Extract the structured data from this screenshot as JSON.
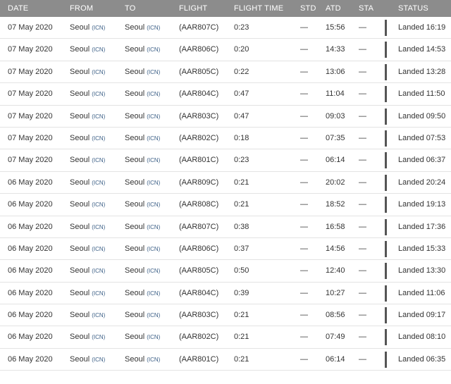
{
  "columns": {
    "date": "DATE",
    "from": "FROM",
    "to": "TO",
    "flight": "FLIGHT",
    "flight_time": "FLIGHT TIME",
    "std": "STD",
    "atd": "ATD",
    "sta": "STA",
    "status": "STATUS"
  },
  "rows": [
    {
      "date": "07 May 2020",
      "from_city": "Seoul",
      "from_code": "(ICN)",
      "to_city": "Seoul",
      "to_code": "(ICN)",
      "flight": "(AAR807C)",
      "flight_time": "0:23",
      "std": "—",
      "atd": "15:56",
      "sta": "—",
      "status": "Landed 16:19"
    },
    {
      "date": "07 May 2020",
      "from_city": "Seoul",
      "from_code": "(ICN)",
      "to_city": "Seoul",
      "to_code": "(ICN)",
      "flight": "(AAR806C)",
      "flight_time": "0:20",
      "std": "—",
      "atd": "14:33",
      "sta": "—",
      "status": "Landed 14:53"
    },
    {
      "date": "07 May 2020",
      "from_city": "Seoul",
      "from_code": "(ICN)",
      "to_city": "Seoul",
      "to_code": "(ICN)",
      "flight": "(AAR805C)",
      "flight_time": "0:22",
      "std": "—",
      "atd": "13:06",
      "sta": "—",
      "status": "Landed 13:28"
    },
    {
      "date": "07 May 2020",
      "from_city": "Seoul",
      "from_code": "(ICN)",
      "to_city": "Seoul",
      "to_code": "(ICN)",
      "flight": "(AAR804C)",
      "flight_time": "0:47",
      "std": "—",
      "atd": "11:04",
      "sta": "—",
      "status": "Landed 11:50"
    },
    {
      "date": "07 May 2020",
      "from_city": "Seoul",
      "from_code": "(ICN)",
      "to_city": "Seoul",
      "to_code": "(ICN)",
      "flight": "(AAR803C)",
      "flight_time": "0:47",
      "std": "—",
      "atd": "09:03",
      "sta": "—",
      "status": "Landed 09:50"
    },
    {
      "date": "07 May 2020",
      "from_city": "Seoul",
      "from_code": "(ICN)",
      "to_city": "Seoul",
      "to_code": "(ICN)",
      "flight": "(AAR802C)",
      "flight_time": "0:18",
      "std": "—",
      "atd": "07:35",
      "sta": "—",
      "status": "Landed 07:53"
    },
    {
      "date": "07 May 2020",
      "from_city": "Seoul",
      "from_code": "(ICN)",
      "to_city": "Seoul",
      "to_code": "(ICN)",
      "flight": "(AAR801C)",
      "flight_time": "0:23",
      "std": "—",
      "atd": "06:14",
      "sta": "—",
      "status": "Landed 06:37"
    },
    {
      "date": "06 May 2020",
      "from_city": "Seoul",
      "from_code": "(ICN)",
      "to_city": "Seoul",
      "to_code": "(ICN)",
      "flight": "(AAR809C)",
      "flight_time": "0:21",
      "std": "—",
      "atd": "20:02",
      "sta": "—",
      "status": "Landed 20:24"
    },
    {
      "date": "06 May 2020",
      "from_city": "Seoul",
      "from_code": "(ICN)",
      "to_city": "Seoul",
      "to_code": "(ICN)",
      "flight": "(AAR808C)",
      "flight_time": "0:21",
      "std": "—",
      "atd": "18:52",
      "sta": "—",
      "status": "Landed 19:13"
    },
    {
      "date": "06 May 2020",
      "from_city": "Seoul",
      "from_code": "(ICN)",
      "to_city": "Seoul",
      "to_code": "(ICN)",
      "flight": "(AAR807C)",
      "flight_time": "0:38",
      "std": "—",
      "atd": "16:58",
      "sta": "—",
      "status": "Landed 17:36"
    },
    {
      "date": "06 May 2020",
      "from_city": "Seoul",
      "from_code": "(ICN)",
      "to_city": "Seoul",
      "to_code": "(ICN)",
      "flight": "(AAR806C)",
      "flight_time": "0:37",
      "std": "—",
      "atd": "14:56",
      "sta": "—",
      "status": "Landed 15:33"
    },
    {
      "date": "06 May 2020",
      "from_city": "Seoul",
      "from_code": "(ICN)",
      "to_city": "Seoul",
      "to_code": "(ICN)",
      "flight": "(AAR805C)",
      "flight_time": "0:50",
      "std": "—",
      "atd": "12:40",
      "sta": "—",
      "status": "Landed 13:30"
    },
    {
      "date": "06 May 2020",
      "from_city": "Seoul",
      "from_code": "(ICN)",
      "to_city": "Seoul",
      "to_code": "(ICN)",
      "flight": "(AAR804C)",
      "flight_time": "0:39",
      "std": "—",
      "atd": "10:27",
      "sta": "—",
      "status": "Landed 11:06"
    },
    {
      "date": "06 May 2020",
      "from_city": "Seoul",
      "from_code": "(ICN)",
      "to_city": "Seoul",
      "to_code": "(ICN)",
      "flight": "(AAR803C)",
      "flight_time": "0:21",
      "std": "—",
      "atd": "08:56",
      "sta": "—",
      "status": "Landed 09:17"
    },
    {
      "date": "06 May 2020",
      "from_city": "Seoul",
      "from_code": "(ICN)",
      "to_city": "Seoul",
      "to_code": "(ICN)",
      "flight": "(AAR802C)",
      "flight_time": "0:21",
      "std": "—",
      "atd": "07:49",
      "sta": "—",
      "status": "Landed 08:10"
    },
    {
      "date": "06 May 2020",
      "from_city": "Seoul",
      "from_code": "(ICN)",
      "to_city": "Seoul",
      "to_code": "(ICN)",
      "flight": "(AAR801C)",
      "flight_time": "0:21",
      "std": "—",
      "atd": "06:14",
      "sta": "—",
      "status": "Landed 06:35"
    }
  ]
}
